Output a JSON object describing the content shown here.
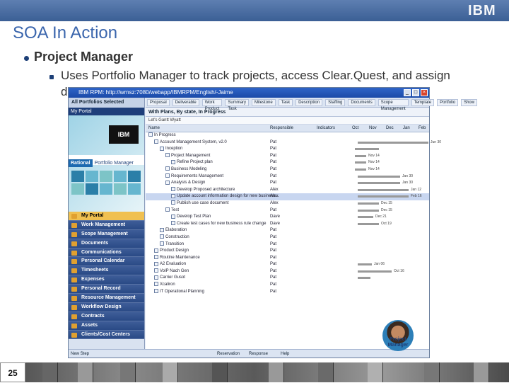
{
  "slide": {
    "title": "SOA In Action",
    "bullet1": "Project Manager",
    "bullet2_line1": "Uses Portfolio Manager to track projects, access Clear.Quest, and assign",
    "bullet2_line2": "deliverables",
    "page_number": "25",
    "logo": "IBM"
  },
  "window": {
    "title": "IBM RPM: http://wrnsz:7080/webapp/IBMRPM/English/-Jaime",
    "left_header": "All Portfolios Selected",
    "left_sub": "My Portal",
    "brand_chip": "Rational",
    "brand_name": "Portfolio Manager",
    "banner_logo": "IBM",
    "nav": [
      "My Portal",
      "Work Management",
      "Scope Management",
      "Documents",
      "Communications",
      "Personal Calendar",
      "Timesheets",
      "Expenses",
      "Personal Record",
      "Resource Management",
      "Workflow Design",
      "Contracts",
      "Assets",
      "Clients/Cost Centers"
    ],
    "new_step": "New Step",
    "toolbar": [
      "Proposal",
      "Deliverable",
      "Work Product",
      "Summary Task",
      "Milestone",
      "Task",
      "Description",
      "Staffing",
      "Documents",
      "Scope Management",
      "Template",
      "Portfolio",
      "Show"
    ],
    "view_title": "With Plans, By state, In Progress",
    "gantt_label": "Let's Gantt Wyatt",
    "columns": {
      "name": "Name",
      "resp": "Responsible",
      "ind": "Indicators",
      "months": [
        "Oct",
        "Nov",
        "Dec",
        "Jan",
        "Feb"
      ]
    },
    "rows": [
      {
        "name": "In Progress",
        "owner": "",
        "indent": 0
      },
      {
        "name": "Account Management System, v2.0",
        "owner": "Pat",
        "indent": 1
      },
      {
        "name": "Inception",
        "owner": "Pat",
        "indent": 2
      },
      {
        "name": "Project Management",
        "owner": "Pat",
        "indent": 3
      },
      {
        "name": "Refine Project plan",
        "owner": "Pat",
        "indent": 4
      },
      {
        "name": "Business Modeling",
        "owner": "Pat",
        "indent": 3
      },
      {
        "name": "Requirements Management",
        "owner": "Pat",
        "indent": 3
      },
      {
        "name": "Analysis & Design",
        "owner": "Pat",
        "indent": 3
      },
      {
        "name": "Develop Proposed architecture",
        "owner": "Alex",
        "indent": 4
      },
      {
        "name": "Update account information design for new business...",
        "owner": "Alex",
        "indent": 4,
        "selected": true
      },
      {
        "name": "Publish use case document",
        "owner": "Alex",
        "indent": 4
      },
      {
        "name": "Test",
        "owner": "Pat",
        "indent": 3
      },
      {
        "name": "Develop Test Plan",
        "owner": "Dave",
        "indent": 4
      },
      {
        "name": "Create test cases for new business rule change",
        "owner": "Dave",
        "indent": 4
      },
      {
        "name": "Elaboration",
        "owner": "Pat",
        "indent": 2
      },
      {
        "name": "Construction",
        "owner": "Pat",
        "indent": 2
      },
      {
        "name": "Transition",
        "owner": "Pat",
        "indent": 2
      },
      {
        "name": "Product Design",
        "owner": "Pat",
        "indent": 1
      },
      {
        "name": "Routine Maintenance",
        "owner": "Pat",
        "indent": 1
      },
      {
        "name": "A2 Evaluation",
        "owner": "Pat",
        "indent": 1
      },
      {
        "name": "VoIP Nach Gen",
        "owner": "Pat",
        "indent": 1
      },
      {
        "name": "Carrier Gusot",
        "owner": "Pat",
        "indent": 1
      },
      {
        "name": "Xcaliron",
        "owner": "Pat",
        "indent": 1
      },
      {
        "name": "IT Operational Planning",
        "owner": "Pat",
        "indent": 1
      }
    ],
    "bar_labels": [
      "Jun 30",
      "Nov 14",
      "Nov 14",
      "Nov 14",
      "Jan 30",
      "Jan 30",
      "Jan 12",
      "Feb 16",
      "Dec 15",
      "Dec 15",
      "Dec 21",
      "Oct 19",
      "Jan 06",
      "Oct 16"
    ],
    "bottom_buttons": [
      "Reservation",
      "Response",
      "Help"
    ]
  },
  "overlay": {
    "name": "Project Manager"
  }
}
